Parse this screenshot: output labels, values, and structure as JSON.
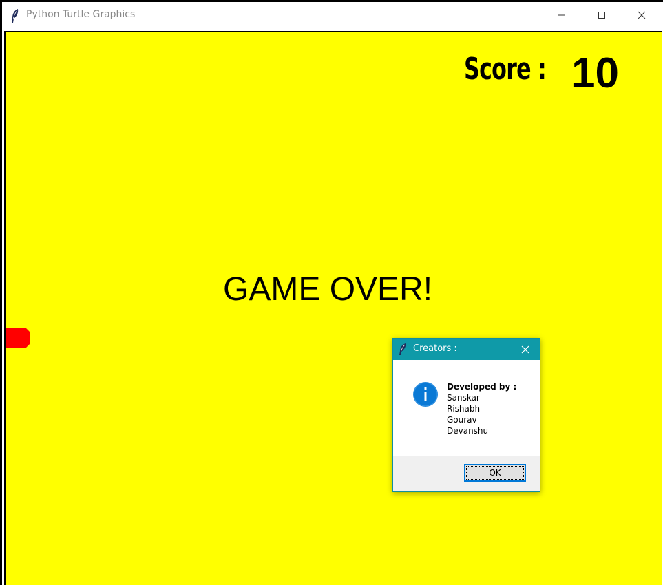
{
  "window": {
    "title": "Python Turtle Graphics",
    "icon": "feather-icon",
    "controls": [
      "minimize-icon",
      "maximize-icon",
      "close-icon"
    ]
  },
  "game": {
    "background_color": "#ffff00",
    "score_label": "Score :",
    "score_value": "10",
    "game_over_text": "GAME OVER!",
    "snake_color": "#ff0000"
  },
  "dialog": {
    "title": "Creators :",
    "titlebar_color": "#0f9aa8",
    "icon": "info-icon",
    "message_lines": [
      "Developed by :",
      "Sanskar",
      "Rishabh",
      "Gourav",
      "Devanshu"
    ],
    "ok_label": "OK"
  }
}
